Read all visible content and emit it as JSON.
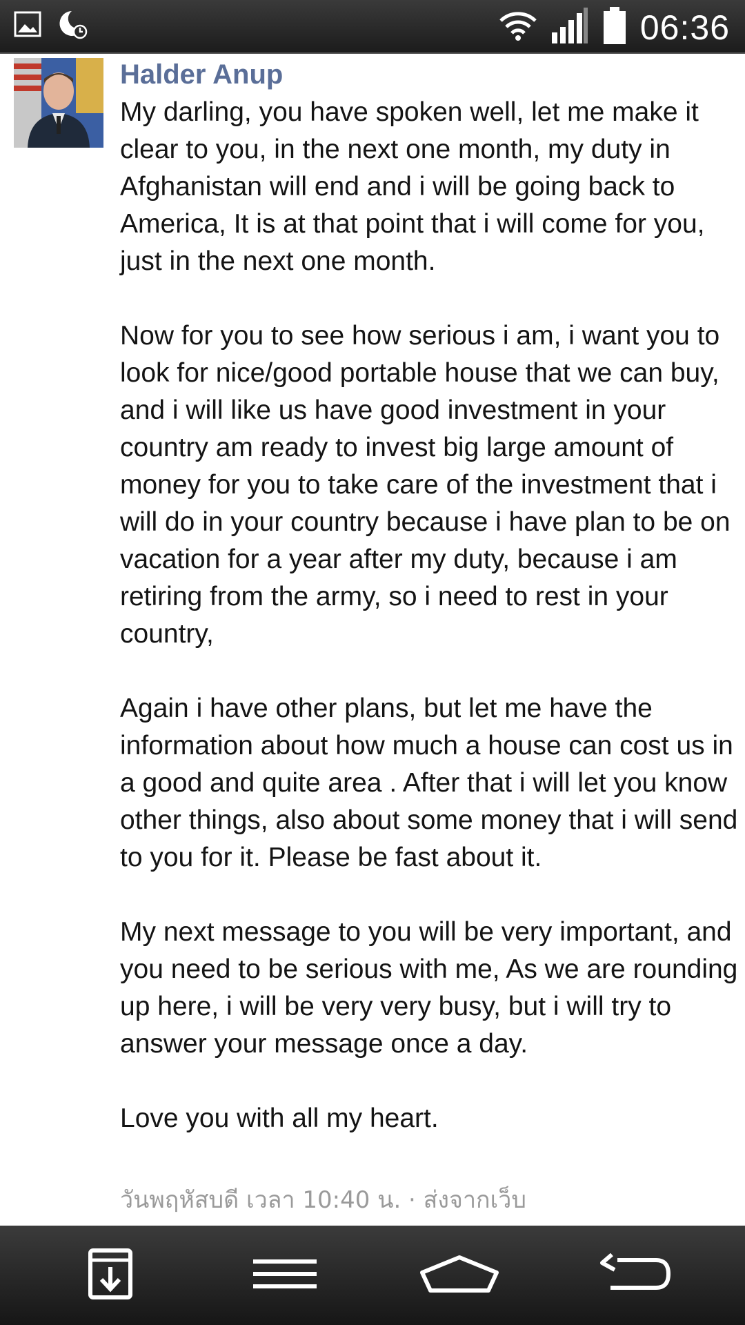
{
  "status_bar": {
    "time": "06:36",
    "icons": [
      "gallery-icon",
      "night-mode-icon",
      "wifi-icon",
      "signal-icon",
      "battery-icon"
    ]
  },
  "message": {
    "sender": "Halder Anup",
    "paragraphs": [
      "My darling, you have spoken well, let me make it clear to you, in the next one month, my duty in Afghanistan will end and i will be going back to America, It is at that point that i will come for you, just in the next one month.",
      "Now for you to see how serious i am, i want you to look for nice/good portable house that we can buy, and i will like us have good investment in your country am ready to invest big large amount of money for you to take care of the investment that i will do in your country because i have plan to be on vacation for a year after my duty, because i am retiring from the army, so i need to rest in your country,",
      "Again i have other plans, but let me have the information about how much a house can cost us in a good and quite area . After that i will let you know other things, also about some money that i will send to you for it. Please be fast about it.",
      "My next message to you will be very important, and you need to be serious with me, As we are rounding up here, i will be very very busy, but i will try to answer your message once a day.",
      "Love you with all my heart."
    ],
    "timestamp": "วันพฤหัสบดี เวลา 10:40 น. · ส่งจากเว็บ"
  },
  "nav_bar": {
    "buttons": [
      "download-icon",
      "menu-icon",
      "home-icon",
      "back-icon"
    ]
  },
  "colors": {
    "sender": "#5a6e98",
    "text": "#141414",
    "timestamp": "#9a9a9a",
    "bars": "#2a2a2a"
  }
}
